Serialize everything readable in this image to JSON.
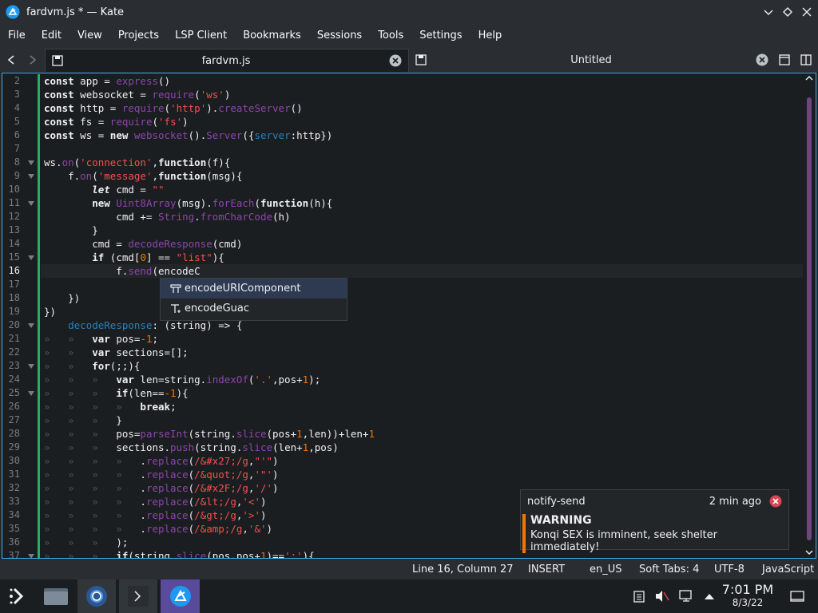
{
  "window": {
    "title": "fardvm.js * — Kate"
  },
  "menu": [
    "File",
    "Edit",
    "View",
    "Projects",
    "LSP Client",
    "Bookmarks",
    "Sessions",
    "Tools",
    "Settings",
    "Help"
  ],
  "tabs": [
    {
      "label": "fardvm.js",
      "active": true
    },
    {
      "label": "Untitled",
      "active": false
    }
  ],
  "editor": {
    "lines": [
      {
        "n": "2",
        "html": "<span class='k'>const</span> app = <span class='f'>express</span>()"
      },
      {
        "n": "3",
        "html": "<span class='k'>const</span> websocket = <span class='f'>require</span>(<span class='s'>'ws'</span>)"
      },
      {
        "n": "4",
        "html": "<span class='k'>const</span> http = <span class='f'>require</span>(<span class='s'>'http'</span>).<span class='f'>createServer</span>()"
      },
      {
        "n": "5",
        "html": "<span class='k'>const</span> fs = <span class='f'>require</span>(<span class='s'>'fs'</span>)"
      },
      {
        "n": "6",
        "html": "<span class='k'>const</span> ws = <span class='k'>new</span> <span class='f'>websocket</span>().<span class='f'>Server</span>({<span class='p'>server</span>:http})"
      },
      {
        "n": "7",
        "html": ""
      },
      {
        "n": "8",
        "html": "ws.<span class='f'>on</span>(<span class='s'>'connection'</span>,<span class='k'>function</span>(f){",
        "fold": true
      },
      {
        "n": "9",
        "html": "    f.<span class='f'>on</span>(<span class='s'>'message'</span>,<span class='k'>function</span>(msg){",
        "fold": true
      },
      {
        "n": "10",
        "html": "        <span class='k'><i>let</i></span> cmd = <span class='s'>\"\"</span>"
      },
      {
        "n": "11",
        "html": "        <span class='k'>new</span> <span class='f'>Uint8Array</span>(msg).<span class='f'>forEach</span>(<span class='k'>function</span>(h){",
        "fold": true
      },
      {
        "n": "12",
        "html": "            cmd += <span class='f'>String</span>.<span class='f'>fromCharCode</span>(h)"
      },
      {
        "n": "13",
        "html": "        }"
      },
      {
        "n": "14",
        "html": "        cmd = <span class='f'>decodeResponse</span>(cmd)"
      },
      {
        "n": "15",
        "html": "        <span class='k'>if</span> (cmd[<span class='n'>0</span>] == <span class='s'>\"list\"</span>){",
        "fold": true
      },
      {
        "n": "16",
        "html": "            f.<span class='f'>send</span>(encodeC",
        "current": true
      },
      {
        "n": "17",
        "html": ""
      },
      {
        "n": "18",
        "html": "    })"
      },
      {
        "n": "19",
        "html": "})"
      },
      {
        "n": "20",
        "html": "    <span class='p'>decodeResponse</span>: (string) => {",
        "fold": true
      },
      {
        "n": "21",
        "html": "<span class='ws'>»   »   </span><span class='k'>var</span> pos=<span class='n'>-1</span>;"
      },
      {
        "n": "22",
        "html": "<span class='ws'>»   »   </span><span class='k'>var</span> sections=[];"
      },
      {
        "n": "23",
        "html": "<span class='ws'>»   »   </span><span class='k'>for</span>(;;){",
        "fold": true
      },
      {
        "n": "24",
        "html": "<span class='ws'>»   »   »   </span><span class='k'>var</span> len=string.<span class='f'>indexOf</span>(<span class='s'>'.'</span>,pos+<span class='n'>1</span>);"
      },
      {
        "n": "25",
        "html": "<span class='ws'>»   »   »   </span><span class='k'>if</span>(len==<span class='n'>-1</span>){",
        "fold": true
      },
      {
        "n": "26",
        "html": "<span class='ws'>»   »   »   »   </span><span class='k'>break</span>;"
      },
      {
        "n": "27",
        "html": "<span class='ws'>»   »   »   </span>}"
      },
      {
        "n": "28",
        "html": "<span class='ws'>»   »   »   </span>pos=<span class='f'>parseInt</span>(string.<span class='f'>slice</span>(pos+<span class='n'>1</span>,len))+len+<span class='n'>1</span>"
      },
      {
        "n": "29",
        "html": "<span class='ws'>»   »   »   </span>sections.<span class='f'>push</span>(string.<span class='f'>slice</span>(len+<span class='n'>1</span>,pos)"
      },
      {
        "n": "30",
        "html": "<span class='ws'>»   »   »   »   </span>.<span class='f'>replace</span>(<span class='s'>/&amp;#x27;/g</span>,<span class='s'>\"'\"</span>)"
      },
      {
        "n": "31",
        "html": "<span class='ws'>»   »   »   »   </span>.<span class='f'>replace</span>(<span class='s'>/&amp;quot;/g</span>,<span class='s'>'\"'</span>)"
      },
      {
        "n": "32",
        "html": "<span class='ws'>»   »   »   »   </span>.<span class='f'>replace</span>(<span class='s'>/&amp;#x2F;/g</span>,<span class='s'>'/'</span>)"
      },
      {
        "n": "33",
        "html": "<span class='ws'>»   »   »   »   </span>.<span class='f'>replace</span>(<span class='s'>/&amp;lt;/g</span>,<span class='s'>'&lt;'</span>)"
      },
      {
        "n": "34",
        "html": "<span class='ws'>»   »   »   »   </span>.<span class='f'>replace</span>(<span class='s'>/&amp;gt;/g</span>,<span class='s'>'&gt;'</span>)"
      },
      {
        "n": "35",
        "html": "<span class='ws'>»   »   »   »   </span>.<span class='f'>replace</span>(<span class='s'>/&amp;amp;/g</span>,<span class='s'>'&amp;'</span>)"
      },
      {
        "n": "36",
        "html": "<span class='ws'>»   »   »   </span>);"
      },
      {
        "n": "37",
        "html": "<span class='ws'>»   »   »   </span><span class='k'>if</span>(string.<span class='f'>slice</span>(pos,pos+<span class='n'>1</span>)==<span class='s'>';'</span>){",
        "fold": true
      }
    ]
  },
  "completion": {
    "items": [
      {
        "label": "encodeURIComponent",
        "icon": "method-icon",
        "selected": true
      },
      {
        "label": "encodeGuac",
        "icon": "text-icon",
        "selected": false
      }
    ]
  },
  "notification": {
    "app": "notify-send",
    "time": "2 min ago",
    "title": "WARNING",
    "message": "Konqi SEX is imminent, seek shelter immediately!",
    "accent": "#f67400"
  },
  "statusbar": {
    "position": "Line 16, Column 27",
    "mode": "INSERT",
    "dictionary": "en_US",
    "indent": "Soft Tabs: 4",
    "encoding": "UTF-8",
    "language": "JavaScript"
  },
  "taskbar": {
    "clock_time": "7:01 PM",
    "clock_date": "8/3/22"
  },
  "colors": {
    "accent": "#3daee9",
    "bg": "#1b1e20",
    "warning": "#f67400",
    "modified": "#27ae60"
  }
}
